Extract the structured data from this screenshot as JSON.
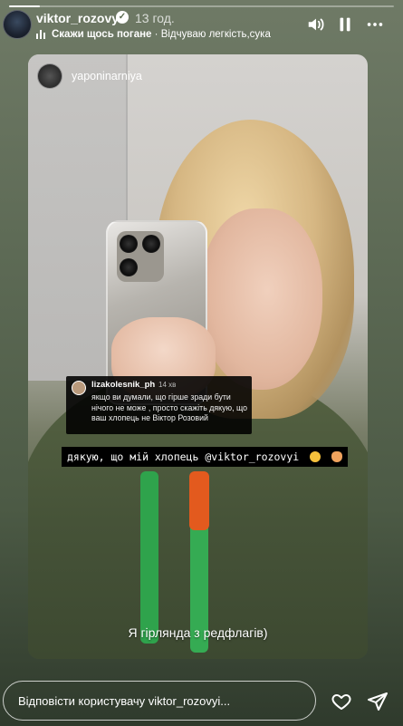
{
  "story": {
    "progress": 0.08,
    "username": "viktor_rozovyi",
    "timestamp": "13 год.",
    "verified_icon": "verified-badge-icon",
    "music": {
      "title": "Скажи щось погане",
      "separator": " · ",
      "artist": "Відчуваю легкість,сука"
    }
  },
  "shared_post": {
    "username": "yaponinarniya",
    "comment": {
      "username": "lizakolesnik_ph",
      "time": "14 хв",
      "text": "якщо ви думали, що гірше зради бути нічого не може , просто скажіть дякую, що ваш хлопець не Віктор Розовий"
    },
    "caption": "дякую, що мій хлопець @viktor_rozovyi",
    "subtitle": "Я гірлянда з редфлагів)"
  },
  "footer": {
    "reply_placeholder": "Відповісти користувачу viktor_rozovyi..."
  },
  "colors": {
    "accent": "#ffffff",
    "background": "#5d6a55",
    "comment_bg": "#000000"
  }
}
